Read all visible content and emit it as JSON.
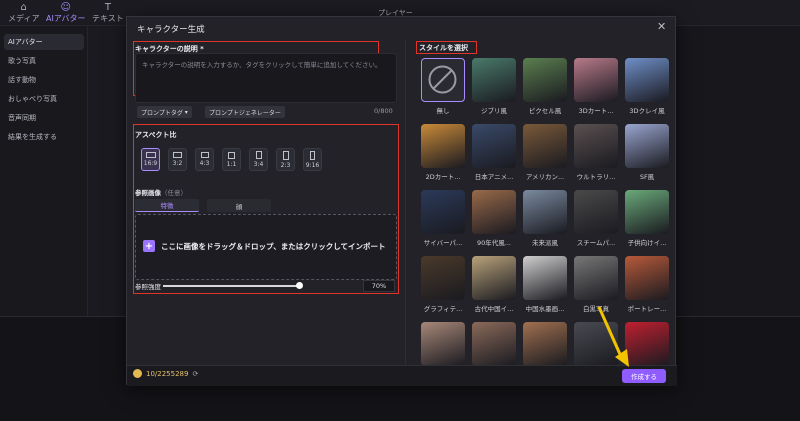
{
  "toolbar": {
    "items": [
      {
        "label": "メディア",
        "icon": "media-icon"
      },
      {
        "label": "AIアバター",
        "icon": "avatar-icon"
      },
      {
        "label": "テキスト",
        "icon": "text-icon"
      }
    ],
    "player_label": "プレイヤー"
  },
  "left_panel": {
    "items": [
      "AIアバター",
      "歌う写真",
      "話す動物",
      "おしゃべり写真",
      "音声同期",
      "結果を生成する"
    ]
  },
  "modal": {
    "title": "キャラクター生成",
    "desc_label": "キャラクターの説明 *",
    "desc_placeholder": "キャラクターの説明を入力するか、タグをクリックして簡単に追加してください。",
    "prompt_tag": "プロンプトタグ",
    "prompt_generator": "プロンプトジェネレーター",
    "counter": "0/800",
    "aspect_label": "アスペクト比",
    "ratios": [
      "16:9",
      "3:2",
      "4:3",
      "1:1",
      "3:4",
      "2:3",
      "9:16"
    ],
    "ref_label": "参照画像",
    "ref_optional": "（任意）",
    "tabs": [
      "特徴",
      "顔"
    ],
    "drop_text": "ここに画像をドラッグ＆ドロップ、またはクリックしてインポート",
    "strength_label": "参照強度",
    "strength_value": "70%",
    "strength_level": 0.7,
    "style_label": "スタイルを選択",
    "styles": [
      "無し",
      "ジブリ風",
      "ピクセル風",
      "3Dカート...",
      "3Dクレイ風",
      "2Dカート...",
      "日本アニメ...",
      "アメリカン...",
      "ウルトラリ...",
      "SF風",
      "サイバーパ...",
      "90年代風...",
      "未来派風",
      "スチームパ...",
      "子供向けイ...",
      "グラフィテ...",
      "古代中国イ...",
      "中国水墨画...",
      "白黒写真",
      "ポートレー...",
      "",
      "",
      "",
      "",
      ""
    ],
    "credits": "10/2255289",
    "create_label": "作成する"
  },
  "colors": {
    "accent": "#8f5cff",
    "highlight": "#e0342a",
    "arrow": "#f2c400"
  }
}
